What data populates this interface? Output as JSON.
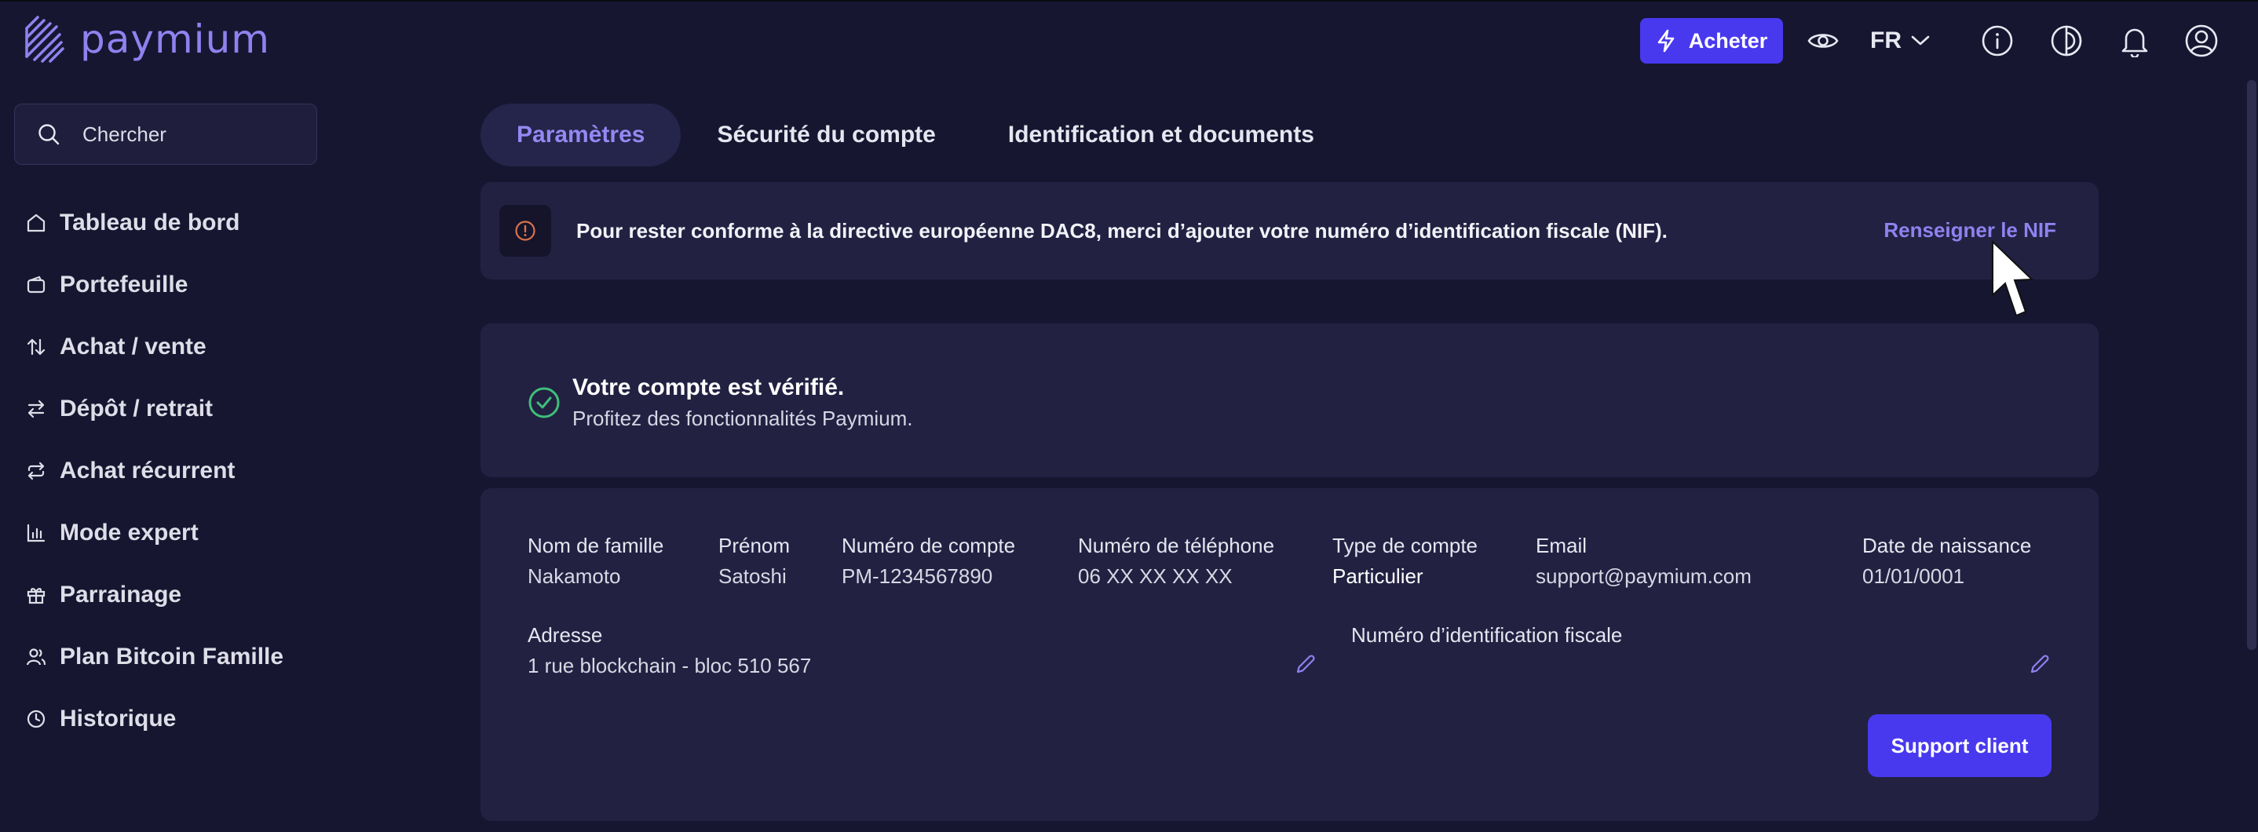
{
  "brand": {
    "name": "paymium",
    "color": "#8f82ef"
  },
  "topbar": {
    "buy_label": "Acheter",
    "language": "FR",
    "icons": [
      "eye-icon",
      "chevron-down-icon",
      "info-icon",
      "contrast-icon",
      "bell-icon",
      "user-circle-icon"
    ]
  },
  "search": {
    "placeholder": "Chercher"
  },
  "sidebar": {
    "items": [
      {
        "label": "Tableau de bord",
        "icon": "home-icon"
      },
      {
        "label": "Portefeuille",
        "icon": "wallet-icon"
      },
      {
        "label": "Achat / vente",
        "icon": "arrows-up-down-icon"
      },
      {
        "label": "Dépôt / retrait",
        "icon": "arrows-left-right-icon"
      },
      {
        "label": "Achat récurrent",
        "icon": "repeat-icon"
      },
      {
        "label": "Mode expert",
        "icon": "bar-chart-icon"
      },
      {
        "label": "Parrainage",
        "icon": "gift-icon"
      },
      {
        "label": "Plan Bitcoin Famille",
        "icon": "users-icon"
      },
      {
        "label": "Historique",
        "icon": "clock-icon"
      }
    ]
  },
  "tabs": [
    {
      "label": "Paramètres",
      "active": true
    },
    {
      "label": "Sécurité du compte",
      "active": false
    },
    {
      "label": "Identification et documents",
      "active": false
    }
  ],
  "alert": {
    "message": "Pour rester conforme à la directive européenne DAC8, merci d’ajouter votre numéro d’identification fiscale (NIF).",
    "action": "Renseigner le NIF"
  },
  "verified": {
    "title": "Votre compte est vérifié.",
    "subtitle": "Profitez des fonctionnalités Paymium."
  },
  "profile": {
    "last_name": {
      "label": "Nom de famille",
      "value": "Nakamoto"
    },
    "first_name": {
      "label": "Prénom",
      "value": "Satoshi"
    },
    "account_number": {
      "label": "Numéro de compte",
      "value": "PM-1234567890"
    },
    "phone": {
      "label": "Numéro de téléphone",
      "value": "06 XX XX XX XX"
    },
    "account_type": {
      "label": "Type de compte",
      "value": "Particulier"
    },
    "email": {
      "label": "Email",
      "value": "support@paymium.com"
    },
    "birth_date": {
      "label": "Date de naissance",
      "value": "01/01/0001"
    },
    "address": {
      "label": "Adresse",
      "value": "1 rue blockchain - bloc 510 567"
    },
    "tax_id": {
      "label": "Numéro d’identification fiscale",
      "value": ""
    },
    "support_label": "Support client"
  },
  "colors": {
    "accent": "#4839ef",
    "background": "#171631",
    "card": "#222142",
    "success": "#3fbf7a",
    "warning": "#d9734a"
  }
}
